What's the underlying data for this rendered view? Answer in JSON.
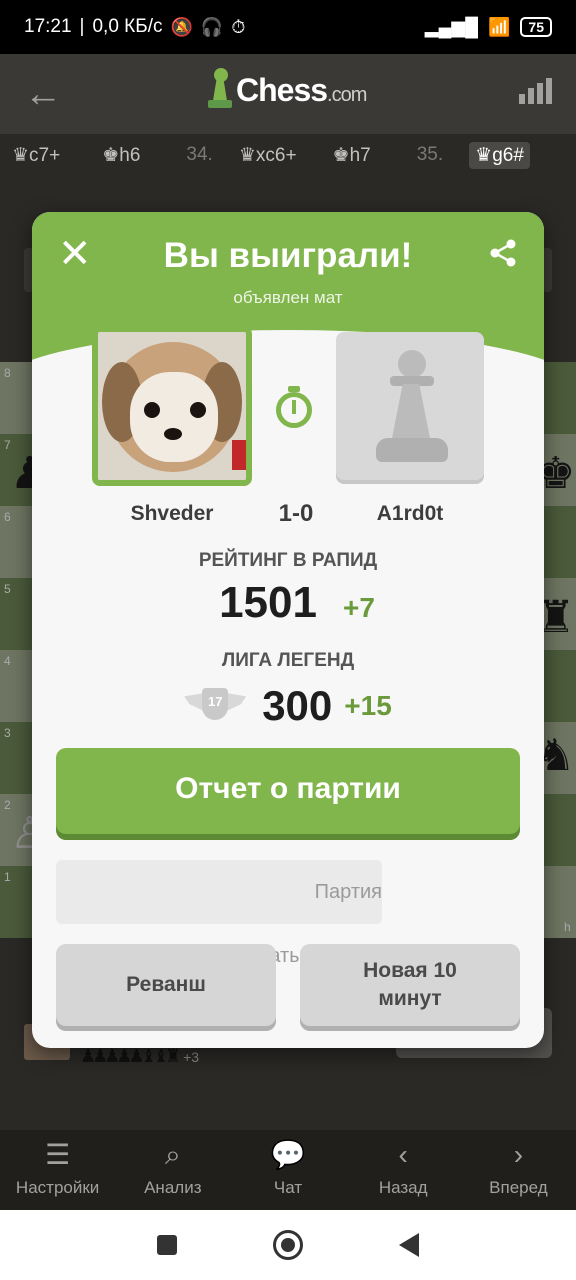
{
  "status_bar": {
    "time": "17:21",
    "network_speed": "0,0 КБ/с",
    "battery": "75",
    "icons": [
      "mute-icon",
      "headset-icon",
      "alarm-icon",
      "signal-icon",
      "wifi-icon",
      "battery-icon"
    ]
  },
  "header": {
    "logo_main": "Chess",
    "logo_suffix": ".com",
    "icons": [
      "back-arrow-icon",
      "stats-icon"
    ]
  },
  "moves": [
    {
      "num": "",
      "piece": "♛",
      "san": "c7+"
    },
    {
      "num": "",
      "piece": "♚",
      "san": "h6"
    },
    {
      "num": "34.",
      "piece": "♛",
      "san": "xc6+"
    },
    {
      "num": "",
      "piece": "♚",
      "san": "h7"
    },
    {
      "num": "35.",
      "piece": "♛",
      "san": "g6#",
      "active": true
    }
  ],
  "board": {
    "ranks": [
      "8",
      "7",
      "6",
      "5",
      "4",
      "3",
      "2",
      "1"
    ],
    "file_label_h": "h"
  },
  "bottom_player": {
    "captured_count": "+3"
  },
  "modal": {
    "title": "Вы выиграли!",
    "subtitle": "объявлен мат",
    "winner_name": "Shveder",
    "loser_name": "A1rd0t",
    "score": "1-0",
    "rating_label": "РЕЙТИНГ В РАПИД",
    "rating_value": "1501",
    "rating_delta": "+7",
    "league_label": "ЛИГА ЛЕГЕНД",
    "league_rank": "17",
    "league_value": "300",
    "league_delta": "+15",
    "report_button": "Отчет о партии",
    "processing_text": "Партия обрабатывается...",
    "rematch_button": "Реванш",
    "new_game_button": "Новая 10 минут"
  },
  "toolbar": {
    "items": [
      {
        "label": "Настройки",
        "icon": "settings-list-icon"
      },
      {
        "label": "Анализ",
        "icon": "analysis-magnifier-icon"
      },
      {
        "label": "Чат",
        "icon": "chat-bubble-icon"
      },
      {
        "label": "Назад",
        "icon": "chevron-left-icon"
      },
      {
        "label": "Вперед",
        "icon": "chevron-right-icon"
      }
    ]
  },
  "colors": {
    "accent_green": "#81b64c",
    "dark_bg": "#262421",
    "modal_bg": "#f7f7f7"
  }
}
